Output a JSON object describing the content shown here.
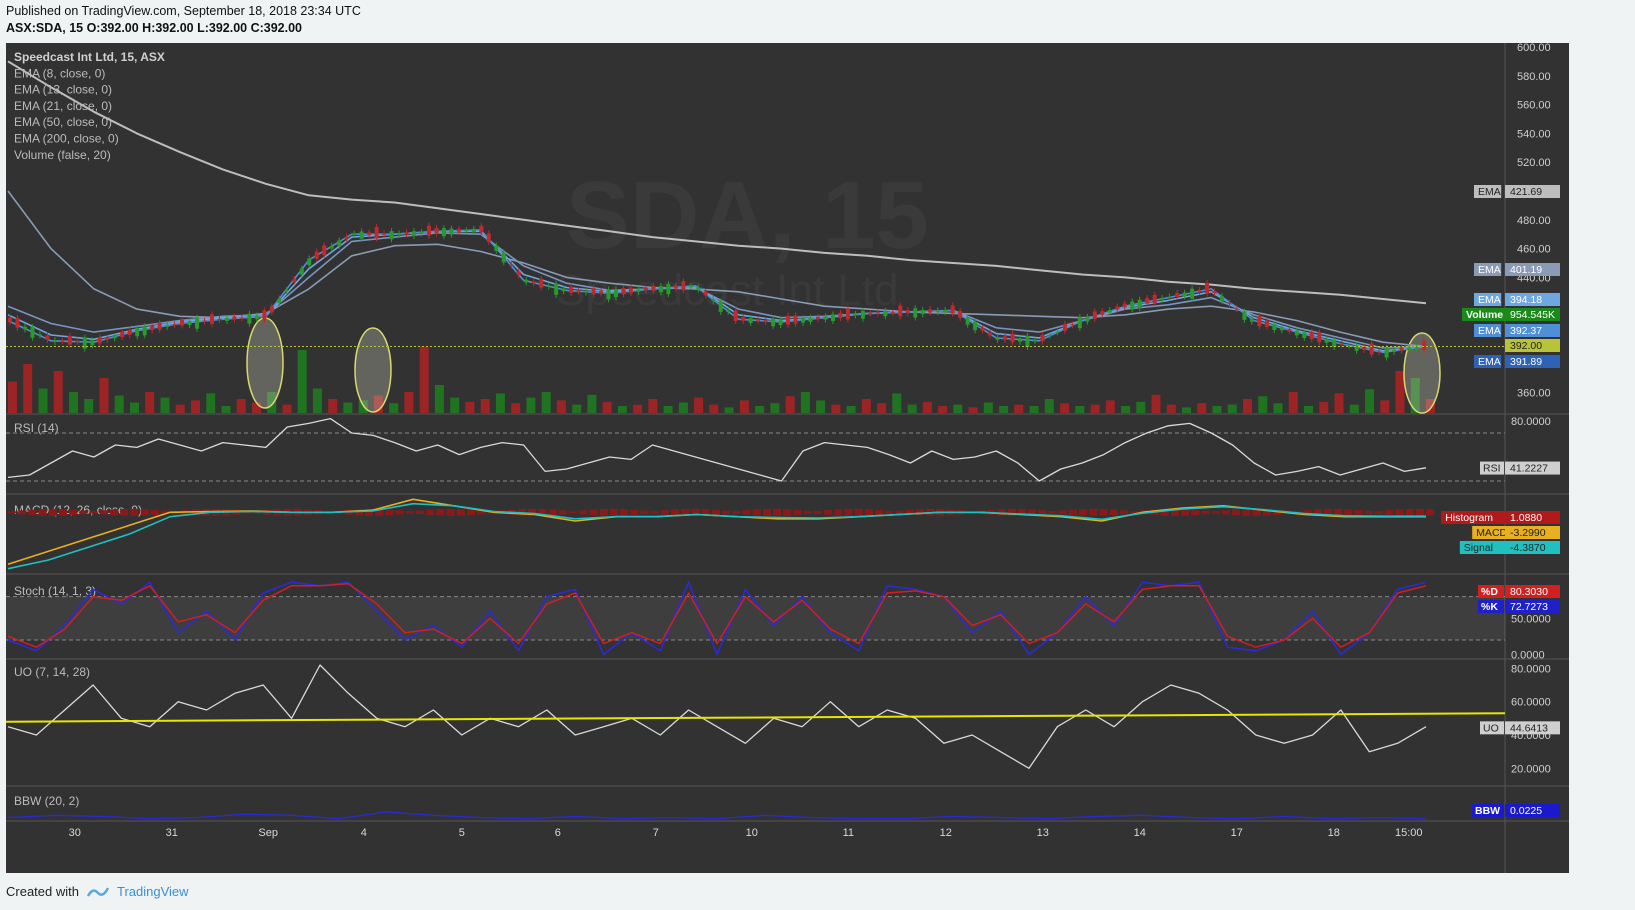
{
  "header": {
    "published": "Published on TradingView.com, September 18, 2018 23:34 UTC",
    "ohlc": "ASX:SDA, 15  O:392.00 H:392.00 L:392.00 C:392.00"
  },
  "footer": {
    "created_with": "Created with",
    "brand": "TradingView"
  },
  "watermark": {
    "symbol": "SDA, 15",
    "name": "Speedcast Int Ltd"
  },
  "legend": [
    "Speedcast Int Ltd, 15, ASX",
    "EMA (8, close, 0)",
    "EMA (13, close, 0)",
    "EMA (21, close, 0)",
    "EMA (50, close, 0)",
    "EMA (200, close, 0)",
    "Volume (false, 20)"
  ],
  "chart_data": [
    {
      "type": "line",
      "name": "price",
      "title": "Speedcast Int Ltd, 15, ASX",
      "y_ticks": [
        "600.00",
        "580.00",
        "560.00",
        "540.00",
        "520.00",
        "480.00",
        "460.00",
        "440.00",
        "360.00"
      ],
      "ylim": [
        350,
        600
      ],
      "x_ticks": [
        "30",
        "31",
        "Sep",
        "4",
        "5",
        "6",
        "7",
        "10",
        "11",
        "12",
        "13",
        "14",
        "17",
        "18",
        "15:00"
      ],
      "series": [
        {
          "name": "EMA (200, close, 0)",
          "color": "#bdbdbd",
          "values": [
            590,
            572,
            555,
            540,
            527,
            515,
            505,
            497,
            494,
            492,
            488,
            484,
            480,
            476,
            472,
            468,
            465,
            462,
            460,
            457,
            455,
            452,
            450,
            448,
            445,
            442,
            440,
            437,
            435,
            432,
            430,
            428,
            425,
            422
          ]
        },
        {
          "name": "EMA (50, close, 0)",
          "color": "#8a9bb5",
          "values": [
            500,
            460,
            432,
            418,
            413,
            412,
            415,
            432,
            455,
            462,
            463,
            458,
            450,
            440,
            436,
            433,
            432,
            430,
            425,
            420,
            418,
            416,
            415,
            414,
            413,
            412,
            414,
            418,
            420,
            416,
            410,
            402,
            395,
            392
          ]
        },
        {
          "name": "EMA (21, close, 0)",
          "color": "#7a94c0",
          "values": [
            420,
            408,
            402,
            406,
            410,
            413,
            414,
            440,
            465,
            468,
            471,
            470,
            448,
            436,
            431,
            432,
            433,
            418,
            412,
            413,
            415,
            416,
            417,
            405,
            402,
            410,
            418,
            421,
            426,
            414,
            405,
            398,
            391,
            392
          ]
        },
        {
          "name": "EMA (13, close, 0)",
          "color": "#6fa8e0",
          "values": [
            414,
            400,
            397,
            404,
            409,
            412,
            413,
            446,
            468,
            470,
            472,
            472,
            442,
            433,
            430,
            432,
            434,
            414,
            410,
            412,
            415,
            416,
            417,
            401,
            398,
            410,
            419,
            424,
            430,
            412,
            403,
            396,
            389,
            392
          ]
        },
        {
          "name": "EMA (8, close, 0)",
          "color": "#4f8fd6",
          "values": [
            410,
            396,
            395,
            403,
            408,
            411,
            413,
            452,
            470,
            470,
            472,
            473,
            438,
            431,
            429,
            432,
            434,
            411,
            409,
            412,
            415,
            416,
            417,
            398,
            396,
            410,
            420,
            426,
            432,
            410,
            402,
            394,
            388,
            392
          ]
        }
      ],
      "last_price": 392.0,
      "labels": [
        {
          "label": "EMA",
          "value": "421.69",
          "color": "#bdbdbd",
          "text": "#222",
          "y": 421.69
        },
        {
          "label": "EMA",
          "value": "401.19",
          "color": "#8a9bb5",
          "text": "#fff",
          "y": 401.19
        },
        {
          "label": "EMA",
          "value": "394.18",
          "color": "#6fa8e0",
          "text": "#fff",
          "y": 394.18
        },
        {
          "label": "Volume",
          "value": "954.545K",
          "color": "#1a8a1a",
          "text": "#fff",
          "y": 390.6
        },
        {
          "label": "EMA",
          "value": "392.37",
          "color": "#4f8fd6",
          "text": "#fff",
          "y": 392.37
        },
        {
          "label": "",
          "value": "392.00",
          "color": "#b8c23a",
          "text": "#222",
          "y": 392.0
        },
        {
          "label": "EMA",
          "value": "391.89",
          "color": "#2d62b5",
          "text": "#fff",
          "y": 391.89
        }
      ]
    },
    {
      "type": "bar",
      "name": "Volume (false, 20)",
      "values": [
        0.45,
        0.7,
        0.35,
        0.6,
        0.3,
        0.2,
        0.5,
        0.25,
        0.15,
        0.3,
        0.22,
        0.12,
        0.18,
        0.28,
        0.1,
        0.2,
        0.15,
        0.3,
        0.12,
        0.9,
        0.35,
        0.2,
        0.15,
        0.18,
        0.25,
        0.14,
        0.3,
        0.95,
        0.4,
        0.22,
        0.16,
        0.2,
        0.28,
        0.14,
        0.22,
        0.3,
        0.18,
        0.12,
        0.26,
        0.16,
        0.1,
        0.12,
        0.2,
        0.1,
        0.15,
        0.22,
        0.12,
        0.08,
        0.18,
        0.1,
        0.14,
        0.24,
        0.3,
        0.18,
        0.12,
        0.1,
        0.2,
        0.14,
        0.28,
        0.12,
        0.16,
        0.1,
        0.12,
        0.08,
        0.15,
        0.1,
        0.12,
        0.1,
        0.2,
        0.14,
        0.1,
        0.12,
        0.18,
        0.1,
        0.16,
        0.26,
        0.12,
        0.08,
        0.14,
        0.1,
        0.12,
        0.2,
        0.24,
        0.14,
        0.3,
        0.1,
        0.16,
        0.28,
        0.12,
        0.34,
        0.18,
        0.6,
        0.5,
        0.2
      ]
    },
    {
      "type": "line",
      "name": "RSI (14)",
      "ylim": [
        20,
        85
      ],
      "y_ticks": [
        "80.0000"
      ],
      "bands": [
        70,
        30
      ],
      "values": [
        33,
        35,
        45,
        55,
        50,
        60,
        58,
        65,
        60,
        55,
        62,
        60,
        58,
        75,
        78,
        82,
        70,
        68,
        62,
        55,
        60,
        52,
        58,
        62,
        60,
        38,
        40,
        45,
        50,
        48,
        60,
        55,
        50,
        45,
        40,
        35,
        30,
        55,
        62,
        60,
        58,
        52,
        45,
        55,
        48,
        50,
        55,
        45,
        30,
        40,
        45,
        52,
        62,
        70,
        76,
        78,
        70,
        60,
        45,
        35,
        38,
        42,
        35,
        40,
        45,
        38,
        41
      ],
      "current": {
        "label": "RSI",
        "value": "41.2227"
      }
    },
    {
      "type": "line",
      "name": "MACD (12, 26, close, 9)",
      "ylim": [
        -14,
        4
      ],
      "series": [
        {
          "name": "MACD",
          "color": "#e8b020",
          "values": [
            -12,
            -9,
            -6,
            -3,
            0,
            0.2,
            0.3,
            0,
            0,
            0.5,
            3,
            1.5,
            0,
            -0.5,
            -2,
            -1,
            -1,
            -0.5,
            -1,
            -1.5,
            -1.5,
            -1,
            -0.5,
            0,
            0,
            -0.5,
            -1,
            -2,
            0,
            1,
            1.5,
            0.5,
            -0.5,
            -1,
            -1,
            -1
          ]
        },
        {
          "name": "Signal",
          "color": "#20c0c0",
          "values": [
            -13,
            -11,
            -8,
            -5,
            -1,
            0,
            0.2,
            0,
            0,
            0.3,
            2,
            1.5,
            0.2,
            -0.3,
            -1.5,
            -1,
            -1,
            -0.5,
            -1,
            -1.2,
            -1.3,
            -1,
            -0.5,
            0,
            0,
            -0.4,
            -0.8,
            -1.6,
            -0.2,
            0.8,
            1.3,
            0.6,
            -0.3,
            -0.8,
            -0.9,
            -0.9
          ]
        }
      ],
      "labels": [
        {
          "label": "Histogram",
          "value": "1.0880",
          "color": "#b01a1a",
          "text": "#fff"
        },
        {
          "label": "MACD",
          "value": "-3.2990",
          "color": "#e8b020",
          "text": "#222"
        },
        {
          "label": "Signal",
          "value": "-4.3870",
          "color": "#20c0c0",
          "text": "#222"
        }
      ]
    },
    {
      "type": "line",
      "name": "Stoch (14, 1, 3)",
      "ylim": [
        -5,
        110
      ],
      "y_ticks": [
        "50.0000",
        "0.0000"
      ],
      "bands": [
        80,
        20
      ],
      "series": [
        {
          "name": "%K",
          "color": "#2a2ae0",
          "values": [
            20,
            5,
            40,
            90,
            70,
            100,
            30,
            60,
            20,
            85,
            100,
            95,
            100,
            60,
            20,
            40,
            10,
            60,
            5,
            80,
            90,
            0,
            30,
            5,
            100,
            0,
            90,
            40,
            80,
            30,
            5,
            95,
            90,
            80,
            30,
            60,
            0,
            30,
            80,
            40,
            100,
            95,
            100,
            10,
            5,
            20,
            60,
            0,
            30,
            90,
            100
          ]
        },
        {
          "name": "%D",
          "color": "#d02020",
          "values": [
            25,
            10,
            35,
            80,
            75,
            95,
            45,
            55,
            30,
            75,
            95,
            95,
            98,
            70,
            30,
            35,
            15,
            50,
            15,
            70,
            85,
            15,
            30,
            15,
            85,
            15,
            80,
            45,
            75,
            35,
            15,
            85,
            88,
            80,
            40,
            55,
            15,
            30,
            70,
            45,
            90,
            95,
            95,
            25,
            10,
            20,
            50,
            10,
            30,
            85,
            95
          ]
        }
      ],
      "labels": [
        {
          "label": "%D",
          "value": "80.3030",
          "color": "#d02020",
          "text": "#fff"
        },
        {
          "label": "%K",
          "value": "72.7273",
          "color": "#2020c8",
          "text": "#fff"
        }
      ]
    },
    {
      "type": "line",
      "name": "UO (7, 14, 28)",
      "ylim": [
        10,
        85
      ],
      "y_ticks": [
        "80.0000",
        "60.0000",
        "40.0000",
        "20.0000"
      ],
      "series": [
        {
          "name": "UO",
          "color": "#d9d9d9",
          "values": [
            45,
            40,
            55,
            70,
            50,
            45,
            60,
            55,
            65,
            70,
            50,
            82,
            65,
            50,
            45,
            55,
            40,
            50,
            45,
            55,
            40,
            45,
            50,
            40,
            55,
            45,
            35,
            50,
            45,
            60,
            45,
            55,
            50,
            35,
            40,
            30,
            20,
            45,
            55,
            45,
            60,
            70,
            65,
            55,
            40,
            35,
            40,
            55,
            30,
            35,
            45
          ]
        },
        {
          "name": "trend",
          "color": "#e6e600",
          "values": [
            48,
            53
          ]
        }
      ],
      "current": {
        "label": "UO",
        "value": "44.6413"
      }
    },
    {
      "type": "line",
      "name": "BBW (20, 2)",
      "series": [
        {
          "name": "BBW",
          "color": "#2a2ad0",
          "values": [
            0.3,
            0.5,
            0.4,
            0.2,
            0.3,
            0.6,
            0.5,
            0.2,
            0.8,
            0.5,
            0.3,
            0.2,
            0.4,
            0.2,
            0.3,
            0.2,
            0.5,
            0.3,
            0.2,
            0.2,
            0.4,
            0.3,
            0.2,
            0.4,
            0.5,
            0.3,
            0.2,
            0.4,
            0.2,
            0.3,
            0.2
          ]
        }
      ],
      "current": {
        "label": "BBW",
        "value": "0.0225"
      }
    }
  ]
}
